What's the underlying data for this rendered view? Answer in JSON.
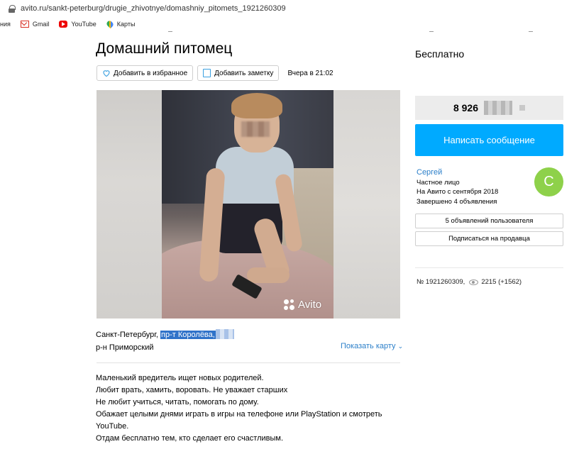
{
  "browser": {
    "url": "avito.ru/sankt-peterburg/drugie_zhivotnye/domashniy_pitomets_1921260309",
    "bookmarks": [
      {
        "label": "ния",
        "icon": "apps-fragment"
      },
      {
        "label": "Gmail",
        "icon": "gmail-icon"
      },
      {
        "label": "YouTube",
        "icon": "youtube-icon"
      },
      {
        "label": "Карты",
        "icon": "maps-icon"
      }
    ]
  },
  "listing": {
    "title": "Домашний питомец",
    "favorite_label": "Добавить в избранное",
    "note_label": "Добавить заметку",
    "date": "Вчера в 21:02",
    "photo_watermark": "Avito",
    "address_city": "Санкт-Петербург,",
    "address_street": "пр-т Королёва,",
    "district": "р-н Приморский",
    "show_map": "Показать карту",
    "description": [
      "Маленький вредитель ищет новых родителей.",
      "Любит врать, хамить, воровать. Не уважает старших",
      "Не любит учиться, читать, помогать по дому.",
      "Обажает целыми днями играть в игры на телефоне или PlayStation и смотреть YouTube.",
      "Отдам бесплатно тем, кто сделает его счастливым."
    ]
  },
  "sidebar": {
    "price": "Бесплатно",
    "phone_prefix": "8 926",
    "message_button": "Написать сообщение",
    "seller_name": "Сергей",
    "seller_type": "Частное лицо",
    "seller_since": "На Авито с сентября 2018",
    "seller_done": "Завершено 4 объявления",
    "avatar_letter": "С",
    "user_ads_button": "5 объявлений пользователя",
    "subscribe_button": "Подписаться на продавца",
    "listing_number": "№ 1921260309,",
    "views": "2215 (+1562)"
  },
  "colors": {
    "accent": "#00aaff",
    "link": "#2b7fc9",
    "avatar": "#8ed14a",
    "selection": "#2f72c9"
  }
}
